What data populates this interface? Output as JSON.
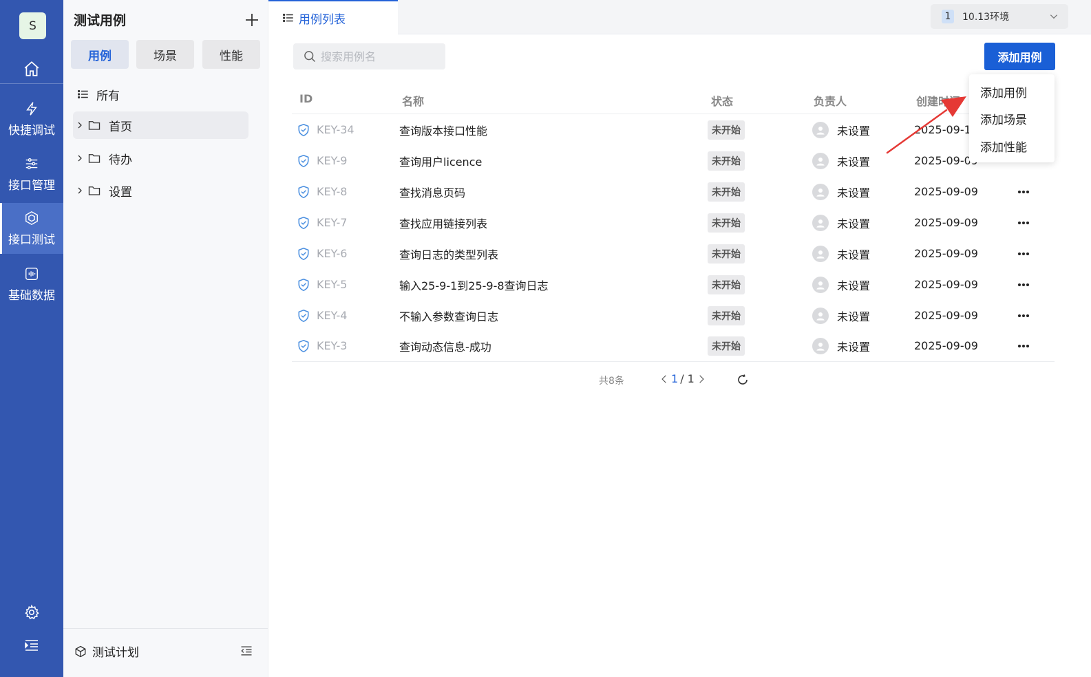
{
  "nav": {
    "avatar": "S",
    "items": [
      {
        "label": "快捷调试",
        "icon": "lightning-icon"
      },
      {
        "label": "接口管理",
        "icon": "sliders-icon"
      },
      {
        "label": "接口测试",
        "icon": "hexagon-icon"
      },
      {
        "label": "基础数据",
        "icon": "waveform-icon"
      }
    ]
  },
  "side": {
    "title": "测试用例",
    "segments": [
      "用例",
      "场景",
      "性能"
    ],
    "all_label": "所有",
    "tree": [
      "首页",
      "待办",
      "设置"
    ],
    "footer_label": "测试计划"
  },
  "tab": {
    "label": "用例列表"
  },
  "env": {
    "num": "1",
    "name": "10.13环境"
  },
  "search": {
    "placeholder": "搜索用例名"
  },
  "add_button": "添加用例",
  "table": {
    "headers": {
      "id": "ID",
      "name": "名称",
      "status": "状态",
      "owner": "负责人",
      "created": "创建时间"
    },
    "rows": [
      {
        "id": "KEY-34",
        "name": "查询版本接口性能",
        "status": "未开始",
        "owner": "未设置",
        "date": "2025-09-10"
      },
      {
        "id": "KEY-9",
        "name": "查询用户licence",
        "status": "未开始",
        "owner": "未设置",
        "date": "2025-09-09"
      },
      {
        "id": "KEY-8",
        "name": "查找消息页码",
        "status": "未开始",
        "owner": "未设置",
        "date": "2025-09-09"
      },
      {
        "id": "KEY-7",
        "name": "查找应用链接列表",
        "status": "未开始",
        "owner": "未设置",
        "date": "2025-09-09"
      },
      {
        "id": "KEY-6",
        "name": "查询日志的类型列表",
        "status": "未开始",
        "owner": "未设置",
        "date": "2025-09-09"
      },
      {
        "id": "KEY-5",
        "name": "输入25-9-1到25-9-8查询日志",
        "status": "未开始",
        "owner": "未设置",
        "date": "2025-09-09"
      },
      {
        "id": "KEY-4",
        "name": "不输入参数查询日志",
        "status": "未开始",
        "owner": "未设置",
        "date": "2025-09-09"
      },
      {
        "id": "KEY-3",
        "name": "查询动态信息-成功",
        "status": "未开始",
        "owner": "未设置",
        "date": "2025-09-09"
      }
    ]
  },
  "pagination": {
    "total": "共8条",
    "current": "1",
    "sep_total": "/ 1"
  },
  "dropdown": [
    "添加用例",
    "添加场景",
    "添加性能"
  ],
  "colors": {
    "nav_bg": "#3357b0",
    "accent": "#2463d8",
    "arrow": "#e53935"
  }
}
